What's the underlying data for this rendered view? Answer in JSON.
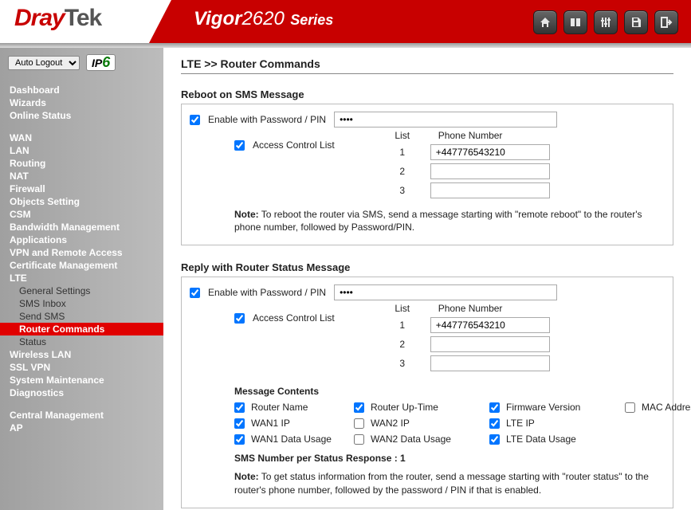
{
  "brand": {
    "part1": "Dray",
    "part2": "Tek"
  },
  "product": {
    "prefix": "Vigor",
    "model": "2620",
    "suffix": "Series"
  },
  "header_icons": [
    "home",
    "dashboard",
    "sliders",
    "save",
    "logout"
  ],
  "top_controls": {
    "auto_logout_label": "Auto Logout",
    "ipv6_prefix": "IP",
    "ipv6_suffix": "6"
  },
  "nav": {
    "group1": [
      {
        "label": "Dashboard"
      },
      {
        "label": "Wizards"
      },
      {
        "label": "Online Status"
      }
    ],
    "group2": [
      {
        "label": "WAN"
      },
      {
        "label": "LAN"
      },
      {
        "label": "Routing"
      },
      {
        "label": "NAT"
      },
      {
        "label": "Firewall"
      },
      {
        "label": "Objects Setting"
      },
      {
        "label": "CSM"
      },
      {
        "label": "Bandwidth Management"
      },
      {
        "label": "Applications"
      },
      {
        "label": "VPN and Remote Access"
      },
      {
        "label": "Certificate Management"
      },
      {
        "label": "LTE",
        "expanded": true,
        "children": [
          {
            "label": "General Settings"
          },
          {
            "label": "SMS Inbox"
          },
          {
            "label": "Send SMS"
          },
          {
            "label": "Router Commands",
            "selected": true
          },
          {
            "label": "Status"
          }
        ]
      },
      {
        "label": "Wireless LAN"
      },
      {
        "label": "SSL VPN"
      },
      {
        "label": "System Maintenance"
      },
      {
        "label": "Diagnostics"
      }
    ],
    "group3": [
      {
        "label": "Central Management"
      },
      {
        "label": "AP"
      }
    ]
  },
  "breadcrumb": "LTE >> Router Commands",
  "labels": {
    "enable_pin": "Enable with Password / PIN",
    "acl": "Access Control List",
    "list": "List",
    "phone": "Phone Number",
    "note_prefix": "Note:"
  },
  "sections": {
    "reboot": {
      "title": "Reboot on SMS Message",
      "enable_checked": true,
      "pin_value": "••••",
      "acl_checked": true,
      "list": [
        {
          "idx": "1",
          "phone": "+447776543210"
        },
        {
          "idx": "2",
          "phone": ""
        },
        {
          "idx": "3",
          "phone": ""
        }
      ],
      "note": "To reboot the router via SMS, send a message starting with \"remote reboot\" to the router's phone number, followed by Password/PIN."
    },
    "status": {
      "title": "Reply with Router Status Message",
      "enable_checked": true,
      "pin_value": "••••",
      "acl_checked": true,
      "list": [
        {
          "idx": "1",
          "phone": "+447776543210"
        },
        {
          "idx": "2",
          "phone": ""
        },
        {
          "idx": "3",
          "phone": ""
        }
      ],
      "msg_contents_title": "Message Contents",
      "options": [
        {
          "label": "Router Name",
          "checked": true
        },
        {
          "label": "Router Up-Time",
          "checked": true
        },
        {
          "label": "Firmware Version",
          "checked": true
        },
        {
          "label": "MAC Address",
          "checked": false
        },
        {
          "label": "WAN1 IP",
          "checked": true
        },
        {
          "label": "WAN2 IP",
          "checked": false
        },
        {
          "label": "LTE IP",
          "checked": true
        },
        {
          "label": "",
          "checked": null
        },
        {
          "label": "WAN1 Data Usage",
          "checked": true
        },
        {
          "label": "WAN2 Data Usage",
          "checked": false
        },
        {
          "label": "LTE Data Usage",
          "checked": true
        },
        {
          "label": "",
          "checked": null
        }
      ],
      "sms_count_label": "SMS Number per Status Response : 1",
      "note": "To get status information from the router, send a message starting with \"router status\" to the router's phone number, followed by the password / PIN if that is enabled."
    }
  }
}
